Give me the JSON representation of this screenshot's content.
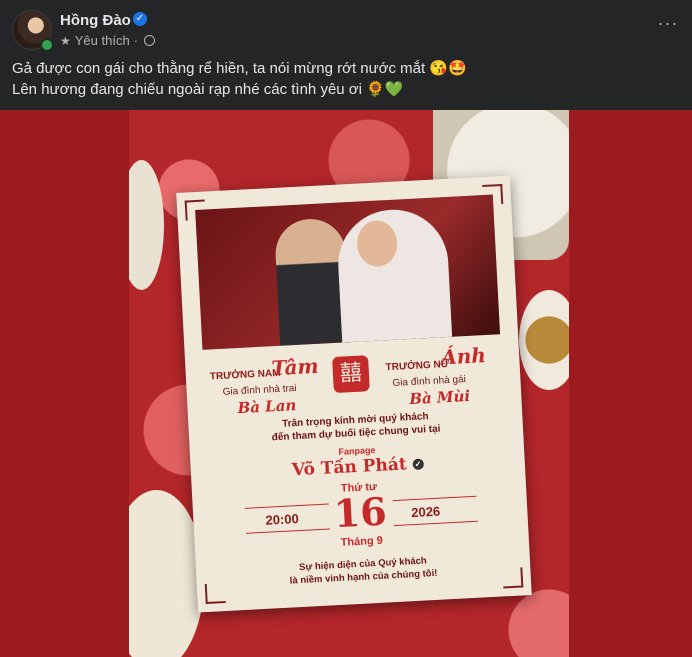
{
  "post": {
    "author": "Hồng Đào",
    "meta_label": "Yêu thích",
    "separator": "·",
    "more_label": "···",
    "caption_line1": "Gả được con gái cho thằng rể hiền, ta nói mừng rớt nước mắt 😘🤩",
    "caption_line2": "Lên hương đang chiếu ngoài rạp nhé các tình yêu ơi 🌻💚"
  },
  "invitation": {
    "groom_side_label": "TRƯỞNG NAM",
    "groom_name": "Tâm",
    "groom_family_label": "Gia đình nhà trai",
    "groom_family_name": "Bà Lan",
    "xi_symbol": "囍",
    "bride_side_label": "TRƯỞNG NỮ",
    "bride_name": "Ánh",
    "bride_family_label": "Gia đình nhà gái",
    "bride_family_name": "Bà Mùi",
    "invite_line1": "Trân trọng kính mời quý khách",
    "invite_line2": "đến tham dự buổi tiệc chung vui tại",
    "fanpage_label": "Fanpage",
    "fanpage_name": "Võ Tấn Phát",
    "day_of_week": "Thứ tư",
    "time": "20:00",
    "day": "16",
    "year": "2026",
    "month": "Tháng 9",
    "closing_line1": "Sự hiện diện của Quý khách",
    "closing_line2": "là niềm vinh hạnh của chúng tôi!"
  },
  "colors": {
    "background": "#242526",
    "media_bg": "#9b1b1e",
    "accent_red": "#c52a2a",
    "verified_blue": "#1b74e4",
    "online_green": "#31a24c"
  }
}
